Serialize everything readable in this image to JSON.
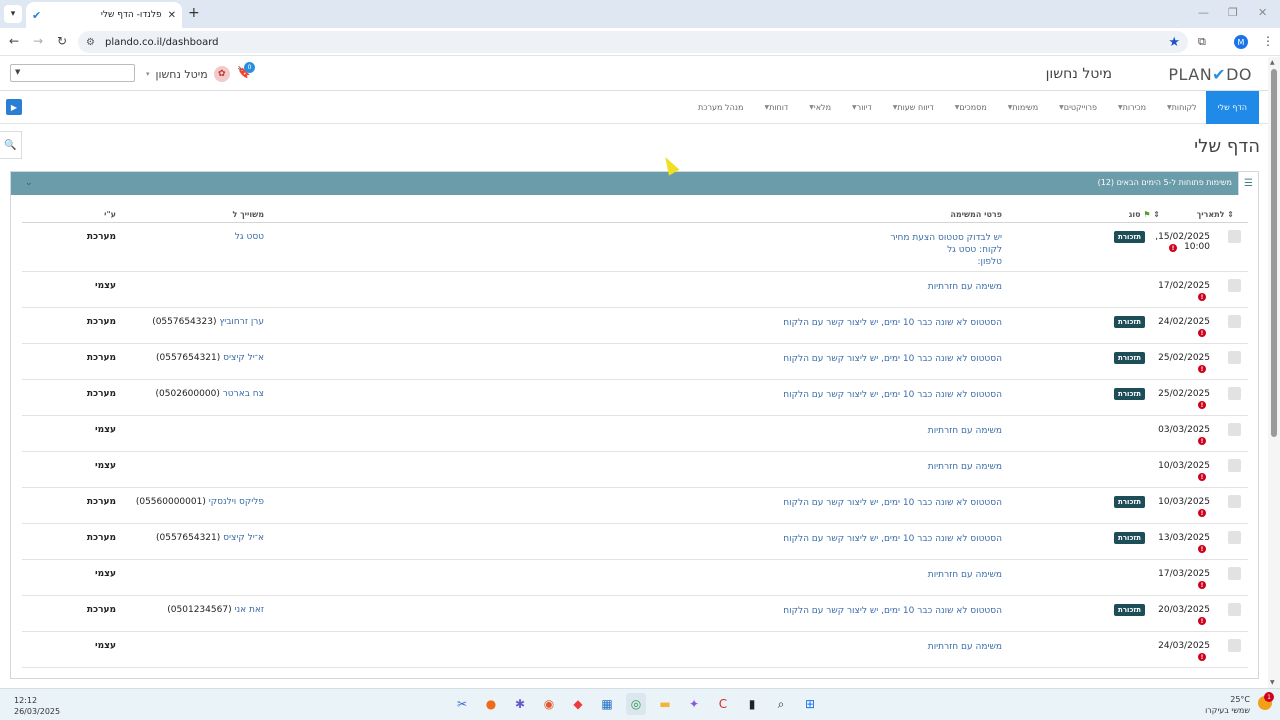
{
  "browser": {
    "tab_title": "פלנדו- הדף שלי",
    "url": "plando.co.il/dashboard",
    "profile_initial": "M",
    "icons": {
      "menu": "▾",
      "favicon": "✔",
      "close": "✕",
      "new_tab": "+",
      "back": "←",
      "forward": "→",
      "reload": "↻",
      "site": "⚙",
      "star": "★",
      "extensions": "⧉",
      "kebab": "⋮",
      "minimize": "—",
      "restore": "❐",
      "win_close": "✕"
    }
  },
  "header": {
    "logo_left": "PLAN",
    "logo_check": "✔",
    "logo_right": "DO",
    "company_name": "מיטל נחשון",
    "user_name": "מיטל נחשון",
    "notifications_count": "0",
    "icons": {
      "caret": "▾",
      "bell": "🔖",
      "avatar": "✿",
      "select_arrow": "▼"
    }
  },
  "nav": {
    "play_icon": "▶",
    "items": [
      {
        "label": "הדף שלי",
        "active": true,
        "dropdown": false
      },
      {
        "label": "לקוחות",
        "active": false,
        "dropdown": true
      },
      {
        "label": "מכירות",
        "active": false,
        "dropdown": true
      },
      {
        "label": "פרוייקטים",
        "active": false,
        "dropdown": true
      },
      {
        "label": "משימות",
        "active": false,
        "dropdown": true
      },
      {
        "label": "מסמכים",
        "active": false,
        "dropdown": true
      },
      {
        "label": "דיווח שעות",
        "active": false,
        "dropdown": true
      },
      {
        "label": "דיוור",
        "active": false,
        "dropdown": true
      },
      {
        "label": "מלאי",
        "active": false,
        "dropdown": true
      },
      {
        "label": "דוחות",
        "active": false,
        "dropdown": true
      },
      {
        "label": "מנהל מערכת",
        "active": false,
        "dropdown": false
      }
    ]
  },
  "page": {
    "title": "הדף שלי",
    "search_icon": "🔍"
  },
  "panel": {
    "title": "משימות פתוחות ל-5 הימים הבאים (12)",
    "list_icon": "☰",
    "collapse_icon": "⌄",
    "columns": {
      "date": "לתאריך",
      "type": "סוג",
      "details": "פרטי המשימה",
      "associated": "משוייך ל",
      "by": "ע\"י"
    },
    "type_badge": "תזכורת",
    "alert_icon": "!",
    "rows": [
      {
        "date": ",15/02/2025",
        "time": "10:00",
        "type": "תזכורת",
        "details": [
          "יש לבדוק סטטוס הצעת מחיר",
          "לקוח: טסט גל",
          "טלפון:"
        ],
        "assoc_name": "טסט גל",
        "assoc_phone": "",
        "by": "מערכת"
      },
      {
        "date": "17/02/2025",
        "time": "",
        "type": "",
        "details": [
          "משימה עם חזרתיות"
        ],
        "assoc_name": "",
        "assoc_phone": "",
        "by": "עצמי"
      },
      {
        "date": "24/02/2025",
        "time": "",
        "type": "תזכורת",
        "details": [
          "הסטטוס לא שונה כבר 10 ימים, יש ליצור קשר עם הלקוח"
        ],
        "assoc_name": "ערן זרחוביץ",
        "assoc_phone": "(0557654323)",
        "by": "מערכת"
      },
      {
        "date": "25/02/2025",
        "time": "",
        "type": "תזכורת",
        "details": [
          "הסטטוס לא שונה כבר 10 ימים, יש ליצור קשר עם הלקוח"
        ],
        "assoc_name": "א־יל קיציס",
        "assoc_phone": "(0557654321)",
        "by": "מערכת"
      },
      {
        "date": "25/02/2025",
        "time": "",
        "type": "תזכורת",
        "details": [
          "הסטטוס לא שונה כבר 10 ימים, יש ליצור קשר עם הלקוח"
        ],
        "assoc_name": "צח בארטר",
        "assoc_phone": "(0502600000)",
        "by": "מערכת"
      },
      {
        "date": "03/03/2025",
        "time": "",
        "type": "",
        "details": [
          "משימה עם חזרתיות"
        ],
        "assoc_name": "",
        "assoc_phone": "",
        "by": "עצמי"
      },
      {
        "date": "10/03/2025",
        "time": "",
        "type": "",
        "details": [
          "משימה עם חזרתיות"
        ],
        "assoc_name": "",
        "assoc_phone": "",
        "by": "עצמי"
      },
      {
        "date": "10/03/2025",
        "time": "",
        "type": "תזכורת",
        "details": [
          "הסטטוס לא שונה כבר 10 ימים, יש ליצור קשר עם הלקוח"
        ],
        "assoc_name": "פליקס וילנסקי",
        "assoc_phone": "(05560000001)",
        "by": "מערכת"
      },
      {
        "date": "13/03/2025",
        "time": "",
        "type": "תזכורת",
        "details": [
          "הסטטוס לא שונה כבר 10 ימים, יש ליצור קשר עם הלקוח"
        ],
        "assoc_name": "א־יל קיציס",
        "assoc_phone": "(0557654321)",
        "by": "מערכת"
      },
      {
        "date": "17/03/2025",
        "time": "",
        "type": "",
        "details": [
          "משימה עם חזרתיות"
        ],
        "assoc_name": "",
        "assoc_phone": "",
        "by": "עצמי"
      },
      {
        "date": "20/03/2025",
        "time": "",
        "type": "תזכורת",
        "details": [
          "הסטטוס לא שונה כבר 10 ימים, יש ליצור קשר עם הלקוח"
        ],
        "assoc_name": "זאת אני",
        "assoc_phone": "(0501234567)",
        "by": "מערכת"
      },
      {
        "date": "24/03/2025",
        "time": "",
        "type": "",
        "details": [
          "משימה עם חזרתיות"
        ],
        "assoc_name": "",
        "assoc_phone": "",
        "by": "עצמי"
      }
    ]
  },
  "taskbar": {
    "time": "12:12",
    "date": "26/03/2025",
    "temperature": "25°C",
    "weather_text": "שמשי בעיקרו",
    "weather_badge": "1",
    "apps": [
      {
        "name": "snipping-tool-icon",
        "glyph": "✂",
        "color": "#3b6fd4"
      },
      {
        "name": "paint-icon",
        "glyph": "●",
        "color": "#f06a1a"
      },
      {
        "name": "settings-icon",
        "glyph": "✱",
        "color": "#6a5acd"
      },
      {
        "name": "firefox-icon",
        "glyph": "◉",
        "color": "#e2582b"
      },
      {
        "name": "anydesk-icon",
        "glyph": "◆",
        "color": "#ef3b3b"
      },
      {
        "name": "store-icon",
        "glyph": "▦",
        "color": "#1e6fbf"
      },
      {
        "name": "chrome-icon",
        "glyph": "◎",
        "color": "#2a9d4b"
      },
      {
        "name": "file-explorer-icon",
        "glyph": "▬",
        "color": "#f2b632"
      },
      {
        "name": "copilot-icon",
        "glyph": "✦",
        "color": "#8c55e0"
      },
      {
        "name": "pdf-icon",
        "glyph": "C",
        "color": "#d62b2b"
      },
      {
        "name": "terminal-icon",
        "glyph": "▮",
        "color": "#222222"
      },
      {
        "name": "search-icon",
        "glyph": "⌕",
        "color": "#333333"
      },
      {
        "name": "windows-start-icon",
        "glyph": "⊞",
        "color": "#1a73e8"
      }
    ]
  },
  "colors": {
    "accent": "#1f8ae8",
    "panel_header": "#6b9ca9",
    "badge": "#1d4d57",
    "alert": "#d0021b",
    "link": "#3b6ca8"
  }
}
